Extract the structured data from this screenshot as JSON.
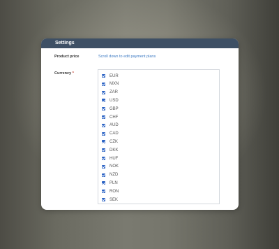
{
  "panel": {
    "title": "Settings"
  },
  "form": {
    "product_price_label": "Product price",
    "product_price_link": "Scroll down to edit payment plans",
    "currency_label": "Currency",
    "required_mark": "*"
  },
  "currencies": [
    {
      "code": "EUR",
      "checked": true
    },
    {
      "code": "MXN",
      "checked": true
    },
    {
      "code": "ZAR",
      "checked": true
    },
    {
      "code": "USD",
      "checked": true
    },
    {
      "code": "GBP",
      "checked": true
    },
    {
      "code": "CHF",
      "checked": true
    },
    {
      "code": "AUD",
      "checked": true
    },
    {
      "code": "CAD",
      "checked": true
    },
    {
      "code": "CZK",
      "checked": true
    },
    {
      "code": "DKK",
      "checked": true
    },
    {
      "code": "HUF",
      "checked": true
    },
    {
      "code": "NOK",
      "checked": true
    },
    {
      "code": "NZD",
      "checked": true
    },
    {
      "code": "PLN",
      "checked": true
    },
    {
      "code": "RON",
      "checked": true
    },
    {
      "code": "SEK",
      "checked": true
    }
  ],
  "colors": {
    "header_bg": "#3e5065",
    "checkbox": "#2d64c5",
    "link": "#3a78c2"
  }
}
